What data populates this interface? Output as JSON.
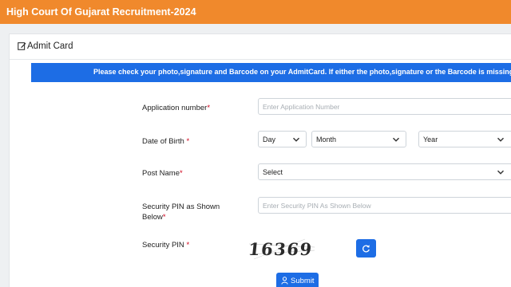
{
  "header": {
    "title": "High Court Of Gujarat Recruitment-2024"
  },
  "card": {
    "title": "Admit Card"
  },
  "notice": {
    "text": "Please check your photo,signature and Barcode on your AdmitCard. If either the photo,signature or the Barcode is missing, kin"
  },
  "form": {
    "application": {
      "label": "Application number",
      "required": "*",
      "placeholder": "Enter Application Number"
    },
    "dob": {
      "label": "Date of Birth",
      "required": "*",
      "day": "Day",
      "month": "Month",
      "year": "Year"
    },
    "post": {
      "label": "Post Name",
      "required": "*",
      "selected": "Select"
    },
    "security_input": {
      "label_line1": "Security PIN as Shown",
      "label_line2": "Below",
      "required": "*",
      "placeholder": "Enter Security PIN As Shown Below"
    },
    "security_pin": {
      "label": "Security PIN",
      "required": "*",
      "captcha_text": "16369"
    },
    "submit_label": "Submit"
  },
  "colors": {
    "brand_orange": "#f0892c",
    "primary_blue": "#1d6de5",
    "required_red": "#d0021b"
  },
  "icons": [
    "edit-icon",
    "chevron-down-icon",
    "refresh-icon",
    "user-icon"
  ]
}
